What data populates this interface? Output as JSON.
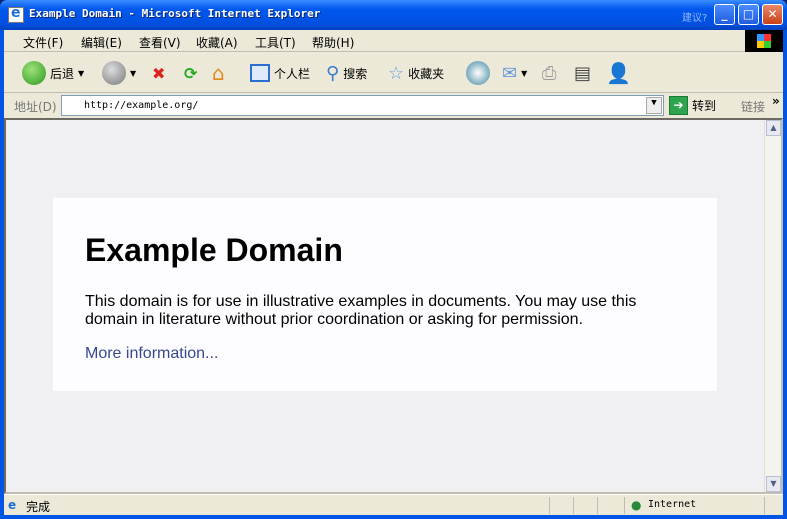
{
  "window": {
    "title": "Example Domain - Microsoft Internet Explorer",
    "suggest": "建议?",
    "minimize": "_",
    "maximize": "□",
    "close": "✕"
  },
  "menu": [
    "文件(F)",
    "编辑(E)",
    "查看(V)",
    "收藏(A)",
    "工具(T)",
    "帮助(H)"
  ],
  "toolbar": {
    "back": "后退",
    "personal_bar": "个人栏",
    "search": "搜索",
    "favorites": "收藏夹"
  },
  "address": {
    "label": "地址(D)",
    "url": "http://example.org/",
    "go": "转到",
    "links": "链接",
    "more": "»"
  },
  "page": {
    "heading": "Example Domain",
    "body": "This domain is for use in illustrative examples in documents. You may use this domain in literature without prior coordination or asking for permission.",
    "link": "More information..."
  },
  "status": {
    "text": "完成",
    "zone": "Internet"
  }
}
